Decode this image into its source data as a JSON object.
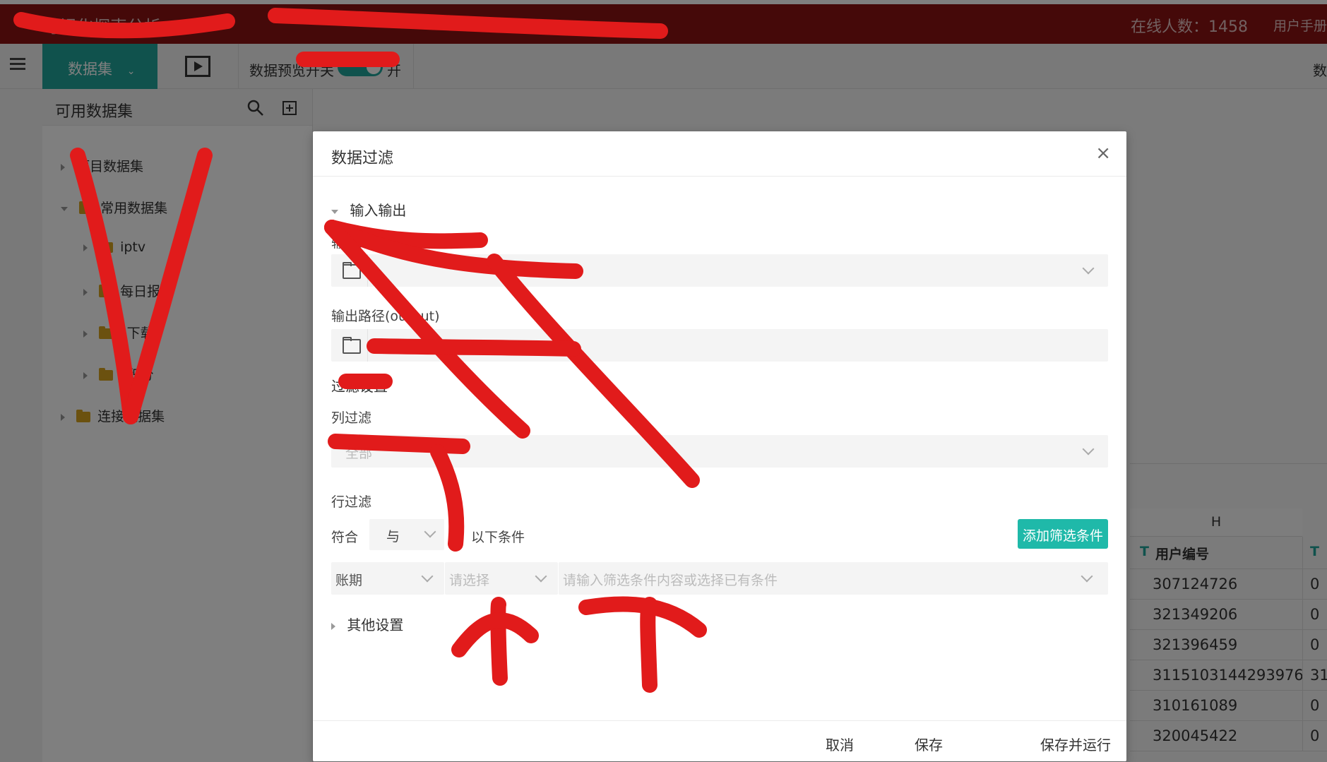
{
  "header": {
    "app_name": "可视化探索分析",
    "online_count": "在线人数：1458",
    "manual": "用户手册"
  },
  "toolbar": {
    "dataset_button": "数据集",
    "preview_toggle_label": "数据预览开关",
    "preview_state": "开",
    "right_label": "数"
  },
  "sidebar": {
    "title": "可用数据集",
    "items": [
      {
        "label": "项目数据集"
      },
      {
        "label": "常用数据集"
      },
      {
        "label": "iptv"
      },
      {
        "label": "每日报表"
      },
      {
        "label": "_下载"
      },
      {
        "label": "_积分"
      },
      {
        "label": "连接数据集"
      }
    ]
  },
  "grid": {
    "column_letter": "H",
    "field_name": "用户编号",
    "rows": [
      "307124726",
      "321349206",
      "321396459",
      "3115103144293976",
      "310161089",
      "320045422"
    ],
    "next_col_rows": [
      "0",
      "0",
      "0",
      "31",
      "0",
      "0"
    ]
  },
  "dialog": {
    "title": "数据过滤",
    "close": "×",
    "io_section": "输入输出",
    "input_path_label": "输入路径",
    "input_path_value": "",
    "output_path_label": "输出路径(output)",
    "output_path_value": "",
    "filter_section": "过滤设置",
    "column_filter_label": "列过滤",
    "column_filter_value": "全部",
    "row_filter_label": "行过滤",
    "match_prefix": "符合",
    "match_operator": "与",
    "match_suffix": "以下条件",
    "add_condition_button": "添加筛选条件",
    "condition_field": "账期",
    "condition_operator_placeholder": "请选择",
    "condition_value_placeholder": "请输入筛选条件内容或选择已有条件",
    "other_section": "其他设置",
    "cancel_button": "取消",
    "save_button": "保存",
    "save_run_button": "保存并运行"
  }
}
